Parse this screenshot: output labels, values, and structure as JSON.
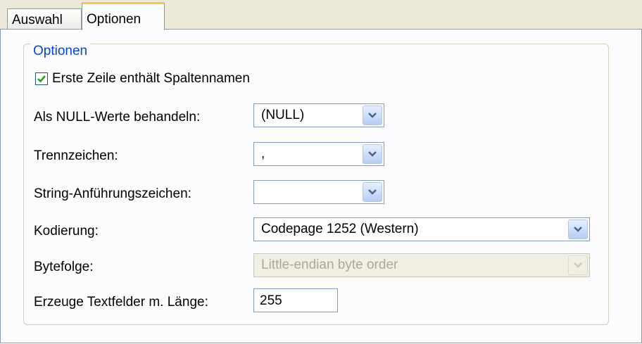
{
  "tabs": [
    {
      "label": "Auswahl",
      "active": false
    },
    {
      "label": "Optionen",
      "active": true
    }
  ],
  "group_title": "Optionen",
  "first_row_header": {
    "label": "Erste Zeile enthält Spaltennamen",
    "checked": true
  },
  "fields": {
    "null_values": {
      "label": "Als NULL-Werte behandeln:",
      "value": "(NULL)"
    },
    "separator": {
      "label": "Trennzeichen:",
      "value": ","
    },
    "string_quote": {
      "label": "String-Anführungszeichen:",
      "value": ""
    },
    "encoding": {
      "label": "Kodierung:",
      "value": "Codepage 1252 (Western)"
    },
    "byte_order": {
      "label": "Bytefolge:",
      "value": "Little-endian byte order",
      "enabled": false
    },
    "text_length": {
      "label": "Erzeuge Textfelder m. Länge:",
      "value": "255"
    }
  },
  "colors": {
    "accent": "#0046d5",
    "tab_highlight": "#ffc83c",
    "check": "#21a121"
  }
}
